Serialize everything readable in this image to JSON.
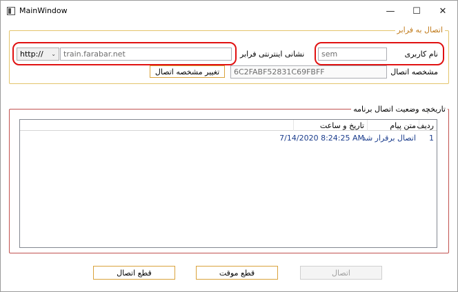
{
  "window": {
    "title": "MainWindow",
    "minimize_glyph": "—",
    "maximize_glyph": "☐",
    "close_glyph": "✕",
    "icon": "window-app-icon"
  },
  "connection_group": {
    "legend": "اتصال به فرابر",
    "username_label": "نام کاربری",
    "username_value": "sem",
    "address_label": "نشانی اینترنتی فرابر",
    "protocol_value": "http://",
    "address_value": "train.farabar.net",
    "conn_id_label": "مشخصه اتصال",
    "conn_id_value": "6C2FABF52831C69FBFF",
    "change_id_button": "تغییر مشخصه اتصال"
  },
  "history_group": {
    "legend": "تاریخچه وضعیت اتصال برنامه",
    "columns": [
      "ردیف",
      "متن پیام",
      "تاریخ و ساعت"
    ],
    "rows": [
      {
        "index": "1",
        "message": "اتصال برقرار شد",
        "datetime": "7/14/2020 8:24:25 AM"
      }
    ]
  },
  "footer": {
    "connect_button": "اتصال",
    "pause_button": "قطع موقت",
    "disconnect_button": "قطع اتصال"
  },
  "colors": {
    "gold_border": "#e3c469",
    "red_border": "#c0504d",
    "annotation_red": "#e01010"
  }
}
